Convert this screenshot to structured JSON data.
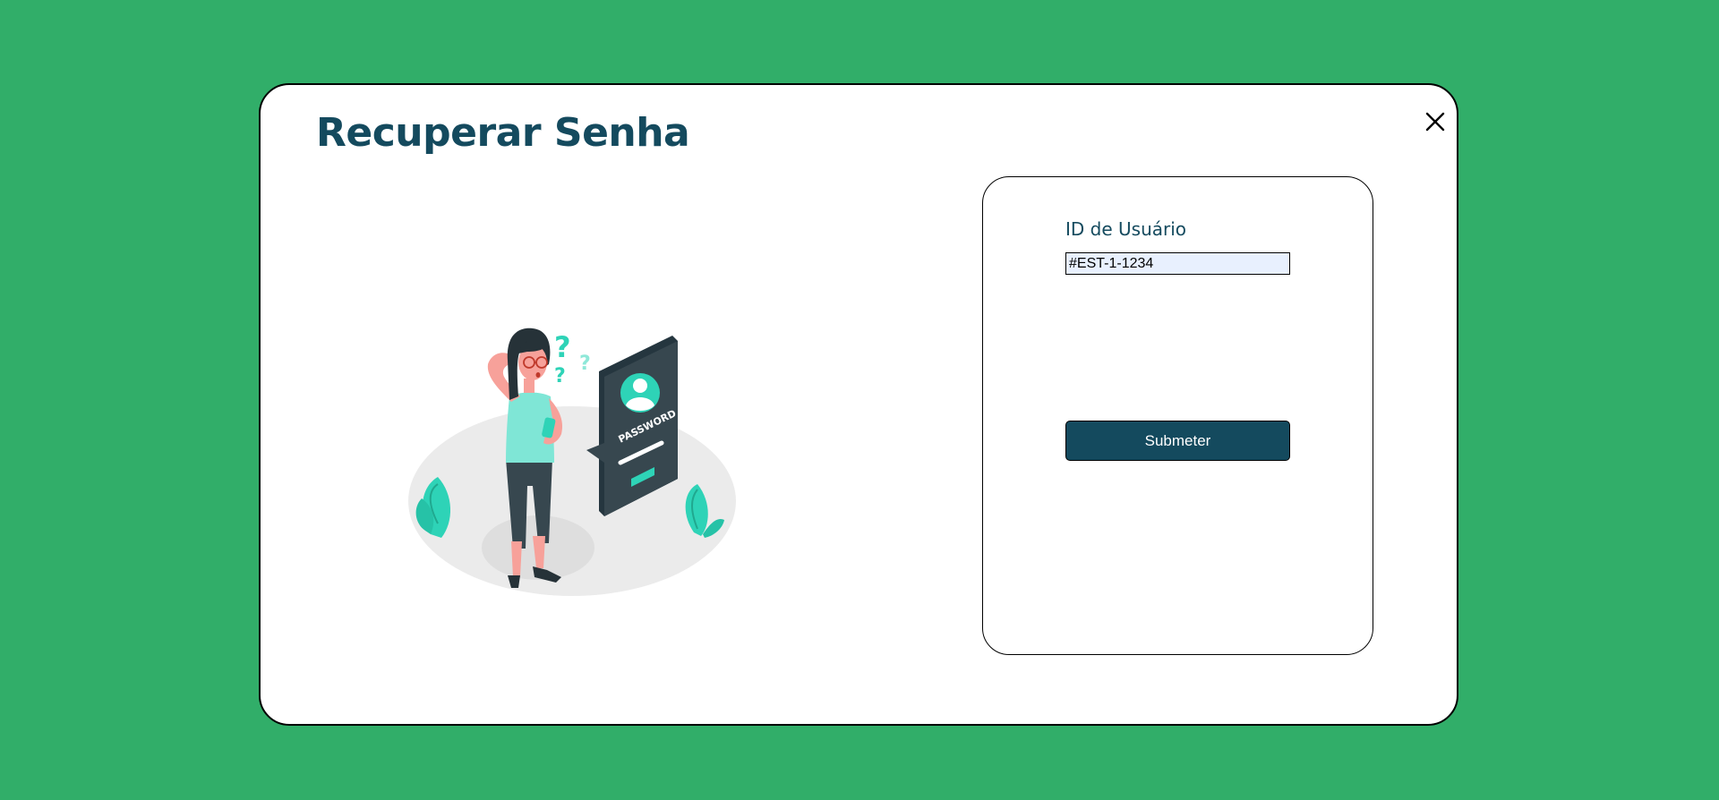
{
  "modal": {
    "title": "Recuperar Senha",
    "close_icon": "close-icon"
  },
  "illustration": {
    "badge_text": "PASSWORD",
    "icon_names": [
      "question-mark-icon",
      "user-icon"
    ]
  },
  "form": {
    "id_label": "ID de Usuário",
    "id_value": "#EST-1-1234",
    "submit_label": "Submeter"
  },
  "colors": {
    "page_background": "#31ae69",
    "primary": "#144a5e",
    "accent": "#2ed3b7",
    "input_background": "#e8f0fe"
  }
}
